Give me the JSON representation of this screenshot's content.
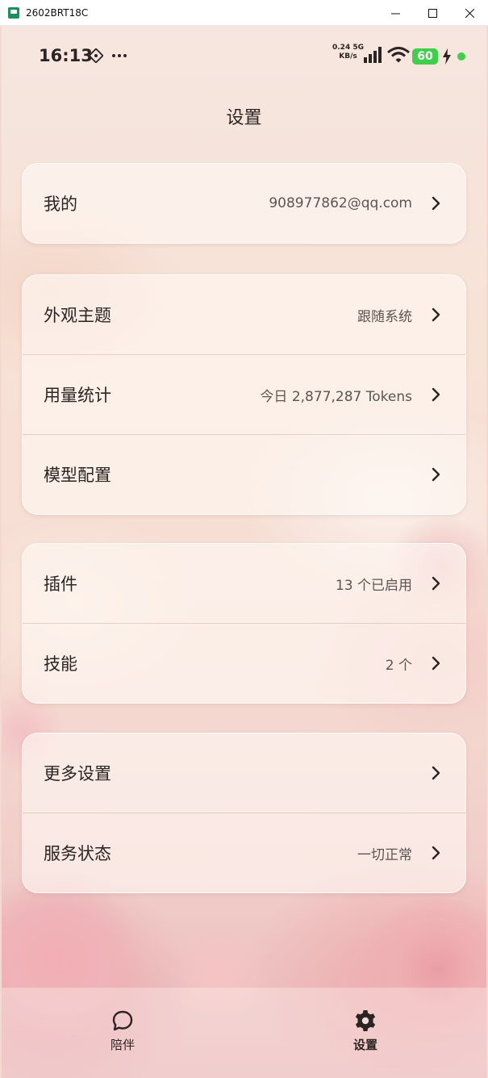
{
  "window": {
    "title": "2602BRT18C",
    "icon": "app-icon",
    "controls": [
      "minimize-icon",
      "maximize-icon",
      "close-icon"
    ]
  },
  "status_bar": {
    "time": "16:13",
    "net_speed_value": "0.24",
    "net_speed_unit": "KB/s",
    "network_type": "5G",
    "battery": "60",
    "icons": [
      "nfc-icon",
      "more-icon",
      "signal-icon",
      "wifi-icon",
      "battery-icon",
      "charging-icon"
    ]
  },
  "header": {
    "title": "设置"
  },
  "groups": [
    {
      "rows": [
        {
          "label": "我的",
          "value": "908977862@qq.com"
        }
      ]
    },
    {
      "rows": [
        {
          "label": "外观主题",
          "value": "跟随系统"
        },
        {
          "label": "用量统计",
          "value": "今日 2,877,287 Tokens"
        },
        {
          "label": "模型配置",
          "value": ""
        }
      ]
    },
    {
      "rows": [
        {
          "label": "插件",
          "value": "13 个已启用"
        },
        {
          "label": "技能",
          "value": "2 个"
        }
      ]
    },
    {
      "rows": [
        {
          "label": "更多设置",
          "value": ""
        },
        {
          "label": "服务状态",
          "value": "一切正常"
        }
      ]
    }
  ],
  "bottom_nav": {
    "items": [
      {
        "label": "陪伴",
        "icon": "chat-bubble-icon",
        "active": false
      },
      {
        "label": "设置",
        "icon": "gear-icon",
        "active": true
      }
    ]
  },
  "colors": {
    "battery_green": "#3fcf4a",
    "text": "#2a2422",
    "secondary_text": "#5d5552"
  }
}
